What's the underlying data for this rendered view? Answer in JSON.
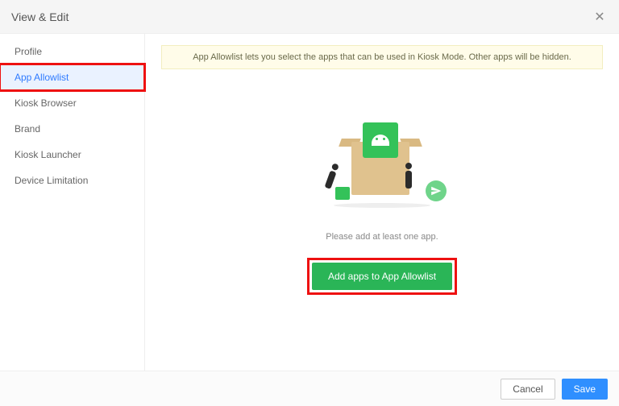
{
  "header": {
    "title": "View & Edit"
  },
  "sidebar": {
    "items": [
      {
        "label": "Profile"
      },
      {
        "label": "App Allowlist"
      },
      {
        "label": "Kiosk Browser"
      },
      {
        "label": "Brand"
      },
      {
        "label": "Kiosk Launcher"
      },
      {
        "label": "Device Limitation"
      }
    ],
    "active_index": 1
  },
  "notice": "App Allowlist lets you select the apps that can be used in Kiosk Mode. Other apps will be hidden.",
  "empty_message": "Please add at least one app.",
  "add_button_label": "Add apps to App Allowlist",
  "footer": {
    "cancel": "Cancel",
    "save": "Save"
  }
}
